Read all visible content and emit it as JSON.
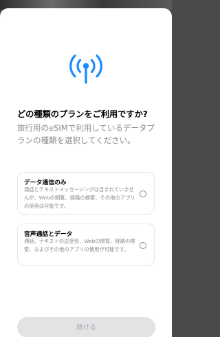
{
  "header": {
    "icon": "cellular-signal-icon",
    "title": "どの種類のプランをご利用ですか?",
    "subtitle": "旅行用のeSIMで利用しているデータプランの種類を選択してください。"
  },
  "options": [
    {
      "title": "データ通信のみ",
      "description": "通話とテキストメッセージングは含まれていませんが、Webの閲覧、経路の検索、その他のアプリの使用は可能です。",
      "selected": false
    },
    {
      "title": "音声通話とデータ",
      "description": "通話、テキストの送受信、Webの閲覧、経路の検索、およびその他のアプリの使用が可能です。",
      "selected": false
    }
  ],
  "footer": {
    "continue_label": "続ける"
  },
  "colors": {
    "accent": "#1a8cff",
    "secondary_text": "#8a8a8e",
    "disabled_button": "#e3e3e5"
  }
}
